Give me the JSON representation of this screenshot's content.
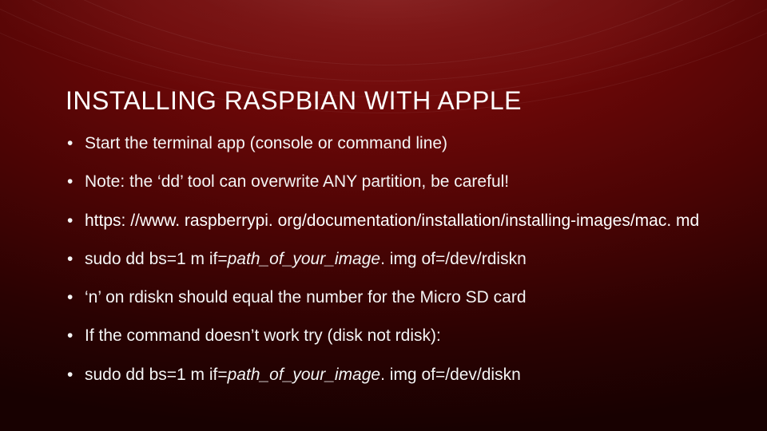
{
  "slide": {
    "title": "INSTALLING RASPBIAN WITH APPLE",
    "bullets": [
      {
        "text": "Start the terminal app (console or command line)"
      },
      {
        "text": "Note: the ‘dd’ tool can overwrite ANY partition, be careful!"
      },
      {
        "text": "https: //www. raspberrypi. org/documentation/installation/installing-images/mac. md",
        "isLink": true
      },
      {
        "prefix": "sudo dd bs=1 m if=",
        "italic": "path_of_your_image",
        "suffix": ". img of=/dev/rdiskn"
      },
      {
        "text": "‘n’ on rdiskn should equal the number for the Micro SD card"
      },
      {
        "text": "If the command doesn’t work try (disk not rdisk):"
      },
      {
        "prefix": "sudo dd bs=1 m if=",
        "italic": "path_of_your_image",
        "suffix": ". img of=/dev/diskn"
      }
    ]
  }
}
